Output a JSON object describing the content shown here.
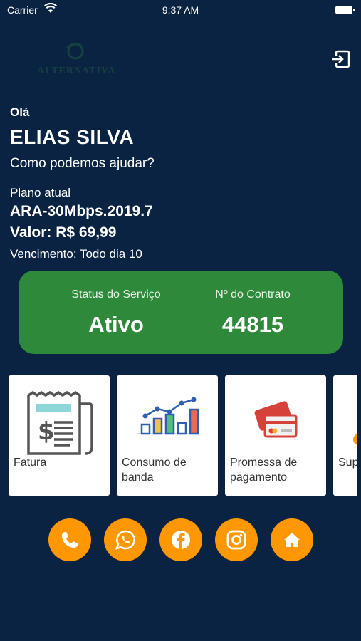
{
  "status_bar": {
    "carrier": "Carrier",
    "time": "9:37 AM"
  },
  "header": {
    "logo_text": "ALTERNATIVA"
  },
  "greeting": {
    "hello": "Olá",
    "name": "ELIAS SILVA",
    "help": "Como podemos ajudar?"
  },
  "plan": {
    "label": "Plano atual",
    "name": "ARA-30Mbps.2019.7",
    "value": "Valor: R$ 69,99",
    "due": "Vencimento: Todo dia 10"
  },
  "service": {
    "status_label": "Status do Serviço",
    "status_value": "Ativo",
    "contract_label": "Nº do Contrato",
    "contract_value": "44815",
    "color": "#2e8a3a"
  },
  "tiles": [
    {
      "label": "Fatura",
      "icon": "invoice-icon"
    },
    {
      "label": "Consumo de banda",
      "icon": "bar-chart-icon"
    },
    {
      "label": "Promessa de pagamento",
      "icon": "credit-card-icon"
    },
    {
      "label": "Sup",
      "icon": "support-icon"
    }
  ],
  "social": [
    {
      "name": "phone-icon"
    },
    {
      "name": "whatsapp-icon"
    },
    {
      "name": "facebook-icon"
    },
    {
      "name": "instagram-icon"
    },
    {
      "name": "home-icon"
    }
  ],
  "colors": {
    "background": "#0b2343",
    "accent": "#ff9800",
    "card": "#2e8a3a"
  }
}
